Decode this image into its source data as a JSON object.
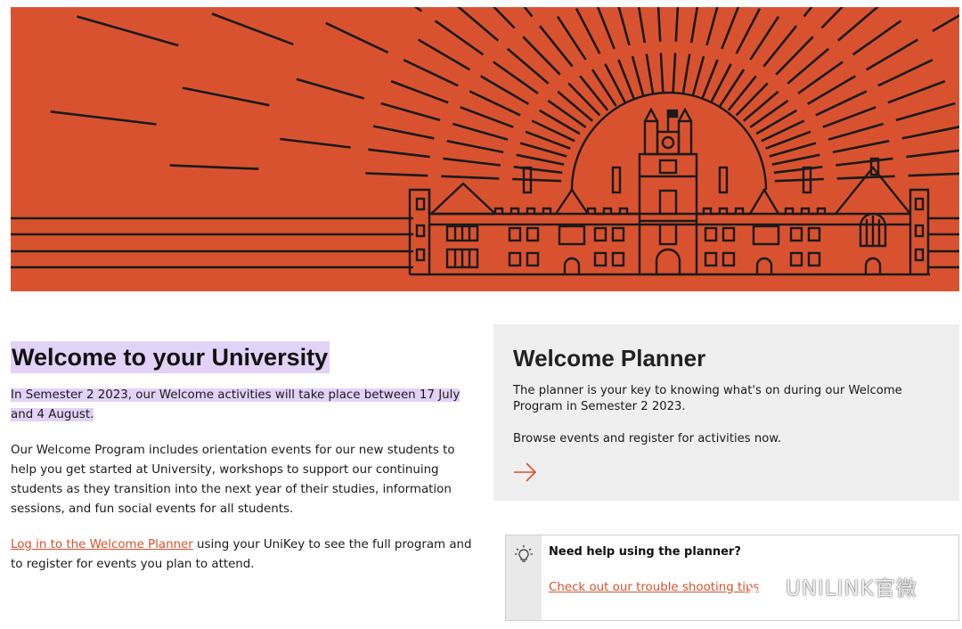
{
  "hero": {
    "background_color": "#d9522f",
    "line_color": "#1a1a1a"
  },
  "intro": {
    "title": "Welcome to your University",
    "highlight_text": "In Semester 2 2023, our Welcome activities will take place between 17 July and 4 August.",
    "highlight_color": "#e2d2f6"
  },
  "program": {
    "description": "Our Welcome Program includes orientation events for our new students to help you get started at University, workshops to support our continuing students as they transition into the next year of their studies, information sessions, and fun social events for all students."
  },
  "login": {
    "link_text": "Log in to the Welcome Planner",
    "rest_text": " using your UniKey to see the full program and to register for events you plan to attend.",
    "link_color": "#d9502b"
  },
  "planner": {
    "title": "Welcome Planner",
    "description": "The planner is your key to knowing what's on during our Welcome Program in Semester 2 2023.",
    "cta": "Browse events and register for activities now.",
    "arrow_icon": "arrow-right-icon"
  },
  "help": {
    "icon": "lightbulb-icon",
    "heading": "Need help using the planner?",
    "link_text": "Check out our trouble shooting tips"
  },
  "watermark": {
    "text": "UNILINK官微",
    "icon": "wechat-icon"
  }
}
